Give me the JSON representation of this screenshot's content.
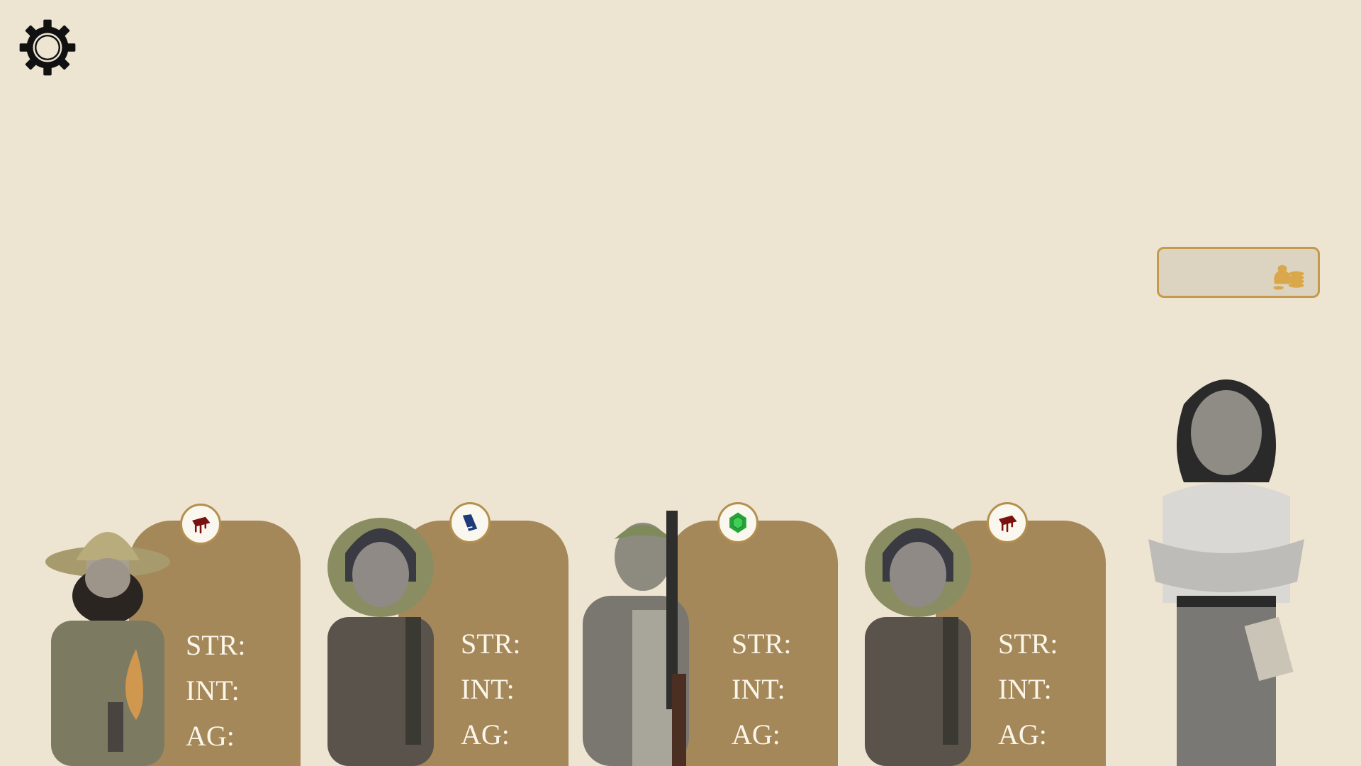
{
  "settings": {
    "icon": "gear-icon"
  },
  "gold": {
    "value": "",
    "icon": "coins-bag-icon",
    "accent": "#c59a4a"
  },
  "cards": [
    {
      "trait": "blood-hat-icon",
      "stats": {
        "str": "STR:",
        "int": "INT:",
        "ag": "AG:"
      }
    },
    {
      "trait": "book-icon",
      "stats": {
        "str": "STR:",
        "int": "INT:",
        "ag": "AG:"
      }
    },
    {
      "trait": "emerald-icon",
      "stats": {
        "str": "STR:",
        "int": "INT:",
        "ag": "AG:"
      }
    },
    {
      "trait": "blood-hat-icon",
      "stats": {
        "str": "STR:",
        "int": "INT:",
        "ag": "AG:"
      }
    }
  ],
  "colors": {
    "background": "#ede4d2",
    "card": "#a5885a",
    "stat_text": "#fbf6ea"
  }
}
